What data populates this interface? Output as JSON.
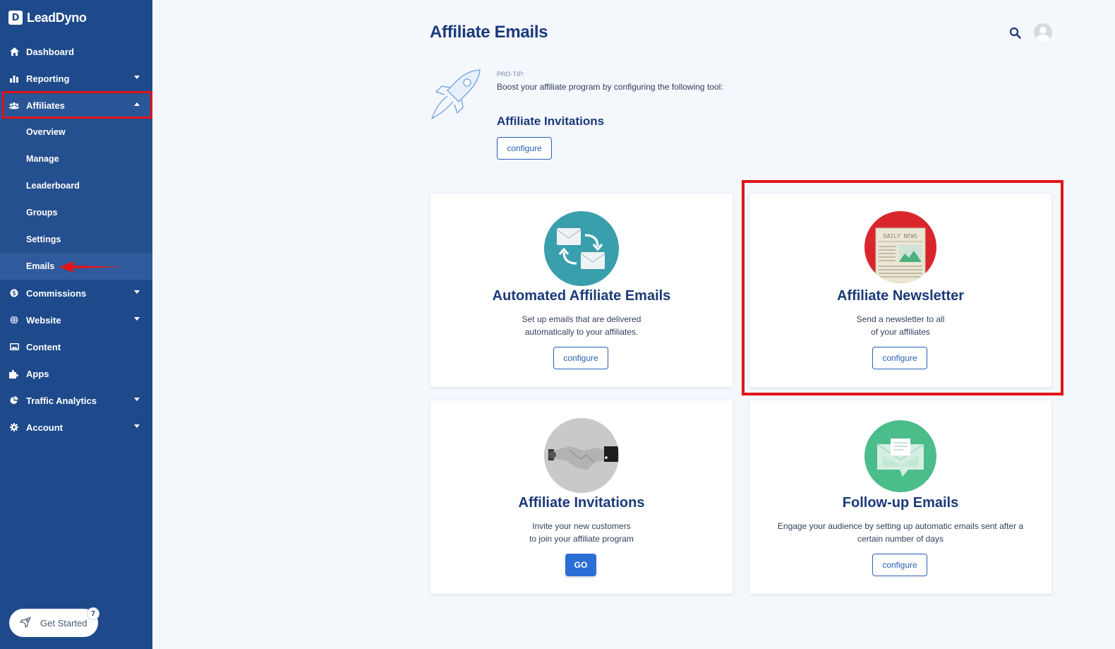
{
  "brand": {
    "name": "LeadDyno",
    "mark": "D"
  },
  "sidebar": {
    "items": [
      {
        "label": "Dashboard",
        "icon": "home-icon"
      },
      {
        "label": "Reporting",
        "icon": "bar-chart-icon"
      },
      {
        "label": "Affiliates",
        "icon": "users-icon"
      },
      {
        "label": "Commissions",
        "icon": "coin-icon"
      },
      {
        "label": "Website",
        "icon": "globe-icon"
      },
      {
        "label": "Content",
        "icon": "image-icon"
      },
      {
        "label": "Apps",
        "icon": "puzzle-icon"
      },
      {
        "label": "Traffic Analytics",
        "icon": "pie-chart-icon"
      },
      {
        "label": "Account",
        "icon": "gear-icon"
      }
    ],
    "affiliates_sub": [
      "Overview",
      "Manage",
      "Leaderboard",
      "Groups",
      "Settings",
      "Emails"
    ],
    "get_started": {
      "label": "Get Started",
      "badge": "7"
    }
  },
  "header": {
    "title": "Affiliate Emails"
  },
  "protip": {
    "label": "PRO-TIP:",
    "text": "Boost your affiliate program by configuring the following tool:",
    "title": "Affiliate Invitations",
    "button": "configure"
  },
  "cards": [
    {
      "title": "Automated Affiliate Emails",
      "desc_line1": "Set up emails that are delivered",
      "desc_line2": "automatically to your affiliates.",
      "button": "configure"
    },
    {
      "title": "Affiliate Newsletter",
      "desc_line1": "Send a newsletter to all",
      "desc_line2": "of your affiliates",
      "button": "configure",
      "image_text": "DAILY NEWS"
    },
    {
      "title": "Affiliate Invitations",
      "desc_line1": "Invite your new customers",
      "desc_line2": "to join your affiliate program",
      "button": "GO"
    },
    {
      "title": "Follow-up Emails",
      "desc_line1": "Engage your audience by setting up automatic emails sent after a",
      "desc_line2": "certain number of days",
      "button": "configure"
    }
  ],
  "colors": {
    "sidebar": "#1e4a8c",
    "accent": "#2b5fb4",
    "highlight": "#e1131a"
  }
}
